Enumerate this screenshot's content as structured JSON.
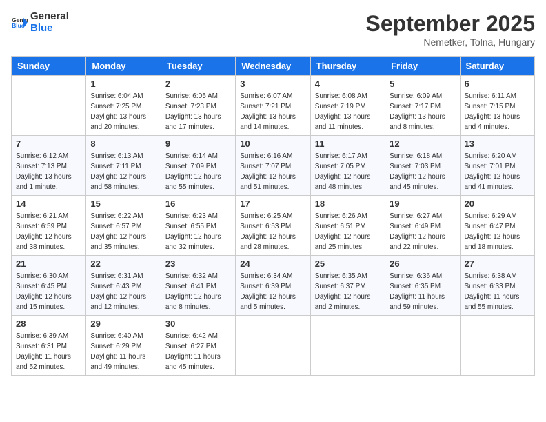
{
  "header": {
    "logo_line1": "General",
    "logo_line2": "Blue",
    "month": "September 2025",
    "location": "Nemetker, Tolna, Hungary"
  },
  "days_of_week": [
    "Sunday",
    "Monday",
    "Tuesday",
    "Wednesday",
    "Thursday",
    "Friday",
    "Saturday"
  ],
  "weeks": [
    [
      {
        "day": "",
        "sunrise": "",
        "sunset": "",
        "daylight": ""
      },
      {
        "day": "1",
        "sunrise": "Sunrise: 6:04 AM",
        "sunset": "Sunset: 7:25 PM",
        "daylight": "Daylight: 13 hours and 20 minutes."
      },
      {
        "day": "2",
        "sunrise": "Sunrise: 6:05 AM",
        "sunset": "Sunset: 7:23 PM",
        "daylight": "Daylight: 13 hours and 17 minutes."
      },
      {
        "day": "3",
        "sunrise": "Sunrise: 6:07 AM",
        "sunset": "Sunset: 7:21 PM",
        "daylight": "Daylight: 13 hours and 14 minutes."
      },
      {
        "day": "4",
        "sunrise": "Sunrise: 6:08 AM",
        "sunset": "Sunset: 7:19 PM",
        "daylight": "Daylight: 13 hours and 11 minutes."
      },
      {
        "day": "5",
        "sunrise": "Sunrise: 6:09 AM",
        "sunset": "Sunset: 7:17 PM",
        "daylight": "Daylight: 13 hours and 8 minutes."
      },
      {
        "day": "6",
        "sunrise": "Sunrise: 6:11 AM",
        "sunset": "Sunset: 7:15 PM",
        "daylight": "Daylight: 13 hours and 4 minutes."
      }
    ],
    [
      {
        "day": "7",
        "sunrise": "Sunrise: 6:12 AM",
        "sunset": "Sunset: 7:13 PM",
        "daylight": "Daylight: 13 hours and 1 minute."
      },
      {
        "day": "8",
        "sunrise": "Sunrise: 6:13 AM",
        "sunset": "Sunset: 7:11 PM",
        "daylight": "Daylight: 12 hours and 58 minutes."
      },
      {
        "day": "9",
        "sunrise": "Sunrise: 6:14 AM",
        "sunset": "Sunset: 7:09 PM",
        "daylight": "Daylight: 12 hours and 55 minutes."
      },
      {
        "day": "10",
        "sunrise": "Sunrise: 6:16 AM",
        "sunset": "Sunset: 7:07 PM",
        "daylight": "Daylight: 12 hours and 51 minutes."
      },
      {
        "day": "11",
        "sunrise": "Sunrise: 6:17 AM",
        "sunset": "Sunset: 7:05 PM",
        "daylight": "Daylight: 12 hours and 48 minutes."
      },
      {
        "day": "12",
        "sunrise": "Sunrise: 6:18 AM",
        "sunset": "Sunset: 7:03 PM",
        "daylight": "Daylight: 12 hours and 45 minutes."
      },
      {
        "day": "13",
        "sunrise": "Sunrise: 6:20 AM",
        "sunset": "Sunset: 7:01 PM",
        "daylight": "Daylight: 12 hours and 41 minutes."
      }
    ],
    [
      {
        "day": "14",
        "sunrise": "Sunrise: 6:21 AM",
        "sunset": "Sunset: 6:59 PM",
        "daylight": "Daylight: 12 hours and 38 minutes."
      },
      {
        "day": "15",
        "sunrise": "Sunrise: 6:22 AM",
        "sunset": "Sunset: 6:57 PM",
        "daylight": "Daylight: 12 hours and 35 minutes."
      },
      {
        "day": "16",
        "sunrise": "Sunrise: 6:23 AM",
        "sunset": "Sunset: 6:55 PM",
        "daylight": "Daylight: 12 hours and 32 minutes."
      },
      {
        "day": "17",
        "sunrise": "Sunrise: 6:25 AM",
        "sunset": "Sunset: 6:53 PM",
        "daylight": "Daylight: 12 hours and 28 minutes."
      },
      {
        "day": "18",
        "sunrise": "Sunrise: 6:26 AM",
        "sunset": "Sunset: 6:51 PM",
        "daylight": "Daylight: 12 hours and 25 minutes."
      },
      {
        "day": "19",
        "sunrise": "Sunrise: 6:27 AM",
        "sunset": "Sunset: 6:49 PM",
        "daylight": "Daylight: 12 hours and 22 minutes."
      },
      {
        "day": "20",
        "sunrise": "Sunrise: 6:29 AM",
        "sunset": "Sunset: 6:47 PM",
        "daylight": "Daylight: 12 hours and 18 minutes."
      }
    ],
    [
      {
        "day": "21",
        "sunrise": "Sunrise: 6:30 AM",
        "sunset": "Sunset: 6:45 PM",
        "daylight": "Daylight: 12 hours and 15 minutes."
      },
      {
        "day": "22",
        "sunrise": "Sunrise: 6:31 AM",
        "sunset": "Sunset: 6:43 PM",
        "daylight": "Daylight: 12 hours and 12 minutes."
      },
      {
        "day": "23",
        "sunrise": "Sunrise: 6:32 AM",
        "sunset": "Sunset: 6:41 PM",
        "daylight": "Daylight: 12 hours and 8 minutes."
      },
      {
        "day": "24",
        "sunrise": "Sunrise: 6:34 AM",
        "sunset": "Sunset: 6:39 PM",
        "daylight": "Daylight: 12 hours and 5 minutes."
      },
      {
        "day": "25",
        "sunrise": "Sunrise: 6:35 AM",
        "sunset": "Sunset: 6:37 PM",
        "daylight": "Daylight: 12 hours and 2 minutes."
      },
      {
        "day": "26",
        "sunrise": "Sunrise: 6:36 AM",
        "sunset": "Sunset: 6:35 PM",
        "daylight": "Daylight: 11 hours and 59 minutes."
      },
      {
        "day": "27",
        "sunrise": "Sunrise: 6:38 AM",
        "sunset": "Sunset: 6:33 PM",
        "daylight": "Daylight: 11 hours and 55 minutes."
      }
    ],
    [
      {
        "day": "28",
        "sunrise": "Sunrise: 6:39 AM",
        "sunset": "Sunset: 6:31 PM",
        "daylight": "Daylight: 11 hours and 52 minutes."
      },
      {
        "day": "29",
        "sunrise": "Sunrise: 6:40 AM",
        "sunset": "Sunset: 6:29 PM",
        "daylight": "Daylight: 11 hours and 49 minutes."
      },
      {
        "day": "30",
        "sunrise": "Sunrise: 6:42 AM",
        "sunset": "Sunset: 6:27 PM",
        "daylight": "Daylight: 11 hours and 45 minutes."
      },
      {
        "day": "",
        "sunrise": "",
        "sunset": "",
        "daylight": ""
      },
      {
        "day": "",
        "sunrise": "",
        "sunset": "",
        "daylight": ""
      },
      {
        "day": "",
        "sunrise": "",
        "sunset": "",
        "daylight": ""
      },
      {
        "day": "",
        "sunrise": "",
        "sunset": "",
        "daylight": ""
      }
    ]
  ]
}
